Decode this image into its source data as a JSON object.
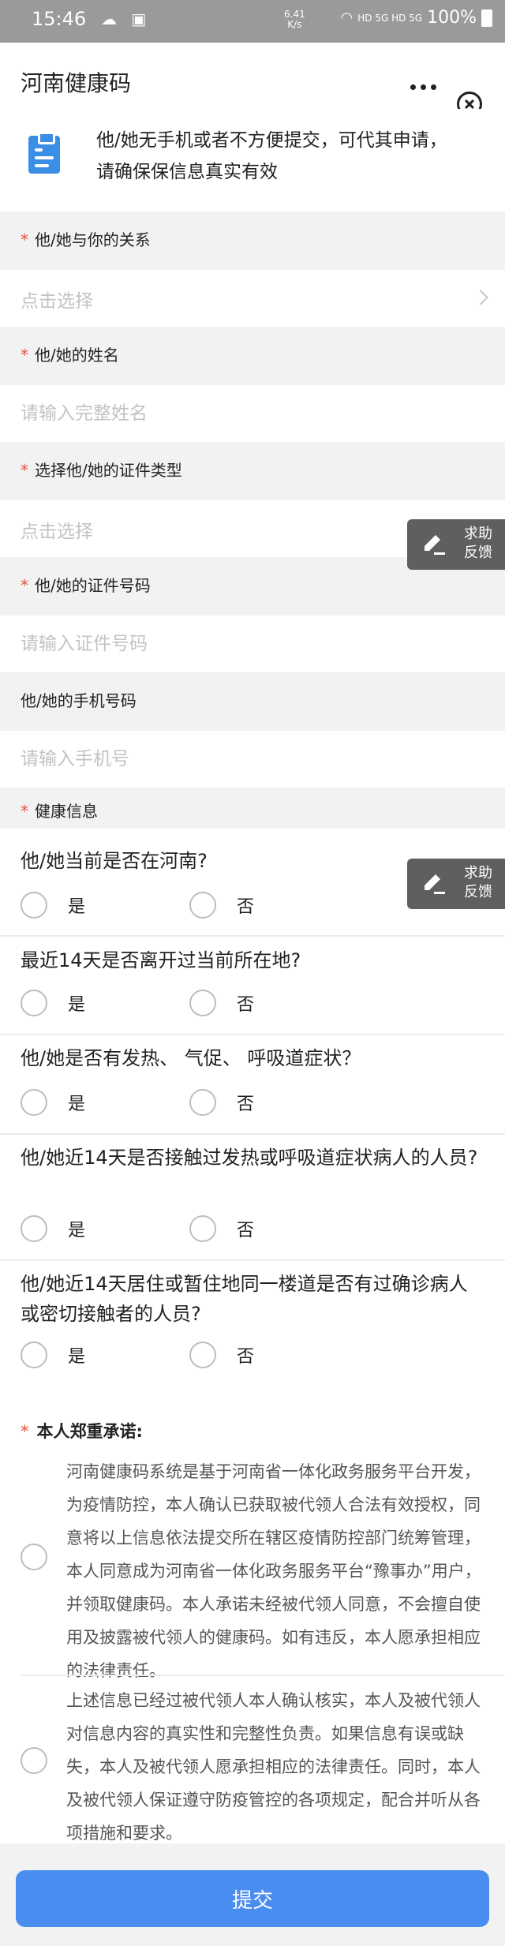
{
  "status_bar": {
    "time": "15:46",
    "net_speed": "6.41",
    "net_unit": "K/s",
    "signal": "HD 5G HD 5G",
    "battery": "100%"
  },
  "header": {
    "title": "河南健康码"
  },
  "notice": {
    "line1": "他/她无手机或者不方便提交，可代其申请，",
    "line2": "请确保保信息真实有效"
  },
  "form": {
    "relation": {
      "label": "他/她与你的关系",
      "placeholder": "点击选择"
    },
    "name": {
      "label": "他/她的姓名",
      "placeholder": "请输入完整姓名"
    },
    "id_type": {
      "label": "选择他/她的证件类型",
      "placeholder": "点击选择"
    },
    "id_number": {
      "label": "他/她的证件号码",
      "placeholder": "请输入证件号码"
    },
    "phone": {
      "label": "他/她的手机号码",
      "placeholder": "请输入手机号"
    },
    "health_label": "健康信息"
  },
  "health_questions": [
    {
      "text": "他/她当前是否在河南?",
      "yes": "是",
      "no": "否"
    },
    {
      "text": "最近14天是否离开过当前所在地?",
      "yes": "是",
      "no": "否"
    },
    {
      "text": "他/她是否有发热、 气促、 呼吸道症状？",
      "yes": "是",
      "no": "否"
    },
    {
      "text": "他/她近14天是否接触过发热或呼吸道症状病人的人员?",
      "yes": "是",
      "no": "否"
    },
    {
      "text": "他/她近14天居住或暂住地同一楼道是否有过确诊病人或密切接触者的人员?",
      "yes": "是",
      "no": "否"
    }
  ],
  "promise": {
    "title": "本人郑重承诺:",
    "items": [
      "河南健康码系统是基于河南省一体化政务服务平台开发，为疫情防控，本人确认已获取被代领人合法有效授权，同意将以上信息依法提交所在辖区疫情防控部门统筹管理，本人同意成为河南省一体化政务服务平台“豫事办”用户，并领取健康码。本人承诺未经被代领人同意，不会擅自使用及披露被代领人的健康码。如有违反，本人愿承担相应的法律责任。",
      "上述信息已经过被代领人本人确认核实，本人及被代领人对信息内容的真实性和完整性负责。如果信息有误或缺失，本人及被代领人愿承担相应的法律责任。同时，本人及被代领人保证遵守防疫管控的各项规定，配合并听从各项措施和要求。"
    ]
  },
  "feedback": {
    "line1": "求助",
    "line2": "反馈"
  },
  "submit_label": "提交",
  "colors": {
    "primary": "#4a8df0",
    "required_star": "#e2513a",
    "icon_blue": "#3a8ee6",
    "feedback_bg": "#5f5f5f"
  }
}
